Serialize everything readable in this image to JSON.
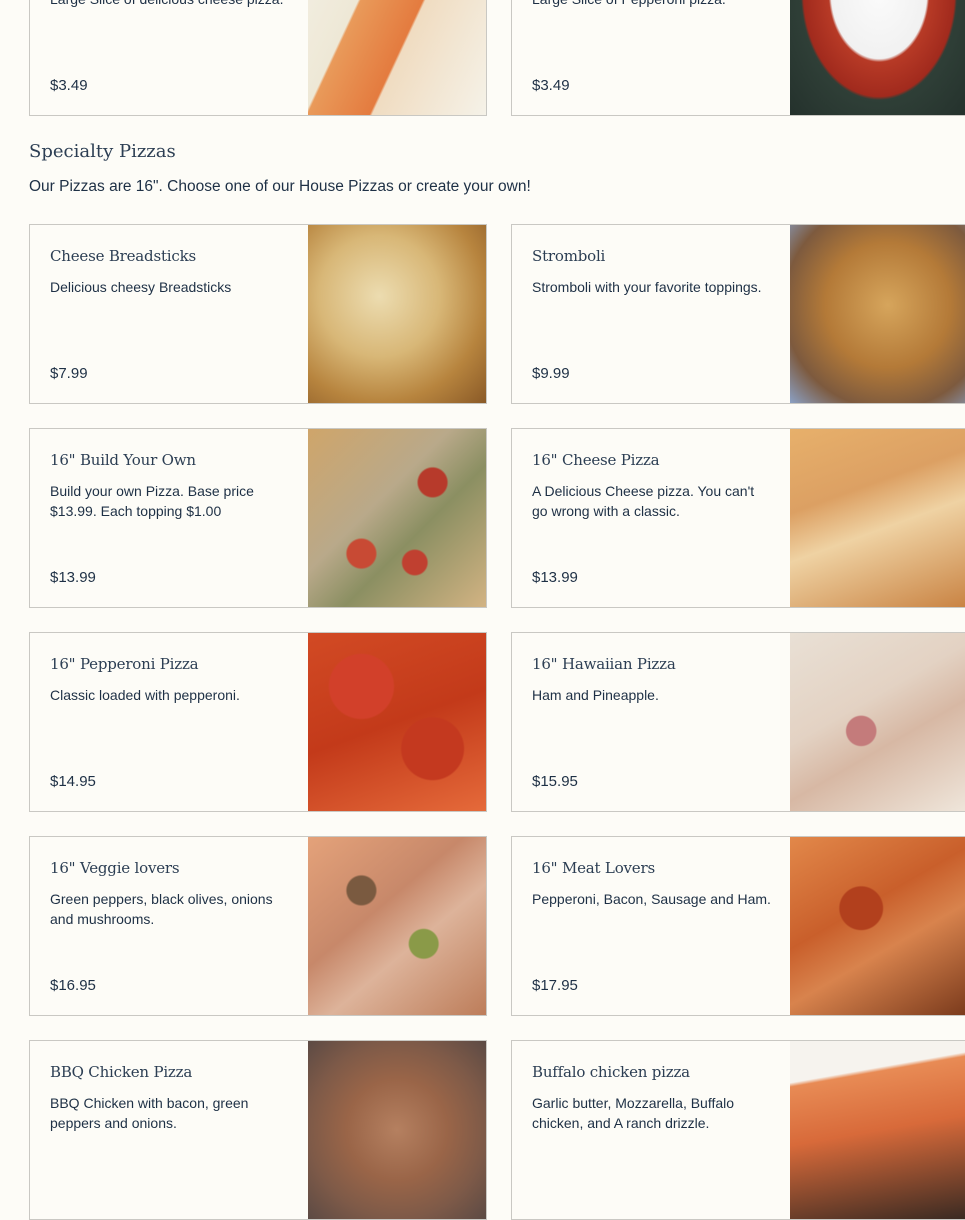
{
  "top_cards": [
    {
      "desc": "Large Slice of delicious cheese pizza.",
      "price": "$3.49",
      "image": "cheese-slice-photo"
    },
    {
      "desc": "Large Slice of Pepperoni pizza.",
      "price": "$3.49",
      "image": "pepperoni-slice-photo"
    }
  ],
  "section": {
    "title": "Specialty Pizzas",
    "subtitle": "Our Pizzas are 16\". Choose one of our House Pizzas or create your own!"
  },
  "items": [
    {
      "name": "Cheese Breadsticks",
      "desc": "Delicious cheesy Breadsticks",
      "price": "$7.99",
      "image": "breadsticks-photo"
    },
    {
      "name": "Stromboli",
      "desc": "Stromboli with your favorite toppings.",
      "price": "$9.99",
      "image": "stromboli-photo"
    },
    {
      "name": "16\" Build Your Own",
      "desc": "Build your own Pizza. Base price $13.99. Each topping $1.00",
      "price": "$13.99",
      "image": "build-your-own-photo"
    },
    {
      "name": "16\" Cheese Pizza",
      "desc": "A Delicious Cheese pizza. You can't go wrong with a classic.",
      "price": "$13.99",
      "image": "cheese-pizza-photo"
    },
    {
      "name": "16\" Pepperoni Pizza",
      "desc": "Classic loaded with pepperoni.",
      "price": "$14.95",
      "image": "pepperoni-pizza-photo"
    },
    {
      "name": "16\" Hawaiian Pizza",
      "desc": "Ham and Pineapple.",
      "price": "$15.95",
      "image": "hawaiian-pizza-photo"
    },
    {
      "name": "16\" Veggie lovers",
      "desc": "Green peppers, black olives, onions and mushrooms.",
      "price": "$16.95",
      "image": "veggie-pizza-photo"
    },
    {
      "name": "16\" Meat Lovers",
      "desc": "Pepperoni, Bacon, Sausage and Ham.",
      "price": "$17.95",
      "image": "meat-lovers-photo"
    },
    {
      "name": "BBQ Chicken Pizza",
      "desc": "BBQ Chicken with bacon, green peppers and onions.",
      "price": "",
      "image": "bbq-chicken-photo"
    },
    {
      "name": "Buffalo chicken pizza",
      "desc": "Garlic butter, Mozzarella, Buffalo chicken, and A ranch drizzle.",
      "price": "",
      "image": "buffalo-chicken-photo"
    }
  ]
}
